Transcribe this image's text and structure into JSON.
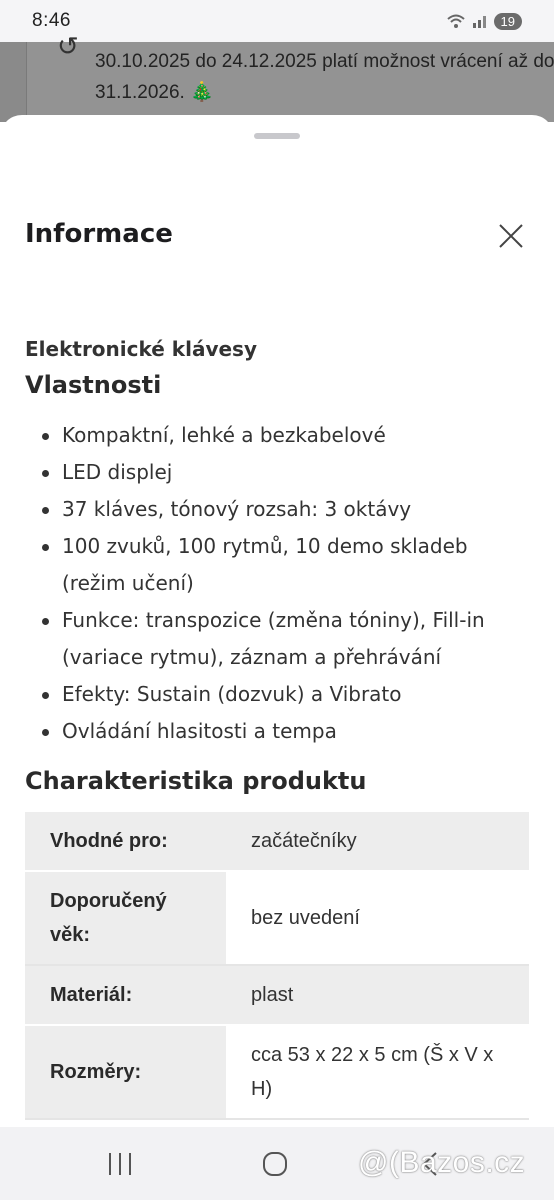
{
  "status_bar": {
    "time": "8:46",
    "battery": "19",
    "icons": [
      "wifi-icon",
      "signal-icon"
    ]
  },
  "background_page": {
    "text": "30.10.2025 do 24.12.2025 platí možnost vrácení až do 31.1.2026. 🎄"
  },
  "sheet": {
    "title": "Informace",
    "product_name": "Elektronické klávesy",
    "features_title": "Vlastnosti",
    "features": [
      "Kompaktní, lehké a bezkabelové",
      "LED displej",
      "37 kláves, tónový rozsah: 3 oktávy",
      "100 zvuků, 100 rytmů, 10 demo skladeb (režim učení)",
      "Funkce: transpozice (změna tóniny), Fill-in (variace rytmu), záznam a přehrávání",
      "Efekty: Sustain (dozvuk) a Vibrato",
      "Ovládání hlasitosti a tempa"
    ],
    "spec_title": "Charakteristika produktu",
    "specs": [
      {
        "label": "Vhodné pro:",
        "value": "začátečníky"
      },
      {
        "label": "Doporučený věk:",
        "value": "bez uvedení"
      },
      {
        "label": "Materiál:",
        "value": "plast"
      },
      {
        "label": "Rozměry:",
        "value": "cca 53 x 22 x 5 cm (Š x V x H)"
      }
    ]
  },
  "watermark": "@(Bazos.cz",
  "colors": {
    "sheet_bg": "#ffffff",
    "table_shade": "#ededed",
    "scrim": "#8a8a8a"
  }
}
